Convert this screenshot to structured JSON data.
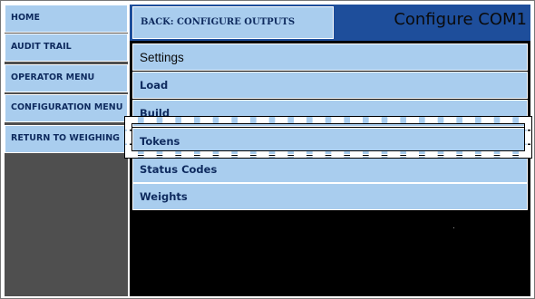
{
  "sidebar": {
    "items": [
      {
        "label": "HOME"
      },
      {
        "label": "AUDIT TRAIL"
      },
      {
        "label": "OPERATOR MENU"
      },
      {
        "label": "CONFIGURATION MENU"
      },
      {
        "label": "RETURN TO WEIGHING"
      }
    ]
  },
  "header": {
    "back_label": "BACK: CONFIGURE OUTPUTS",
    "title": "Configure COM1"
  },
  "menu": {
    "section_label": "Settings",
    "items": [
      {
        "label": "Load"
      },
      {
        "label": "Build"
      },
      {
        "label": "Tokens",
        "highlighted": true
      },
      {
        "label": "Status Codes"
      },
      {
        "label": "Weights"
      }
    ]
  },
  "colors": {
    "button_fill": "#a9cdee",
    "title_bar": "#1e4e9b",
    "sidebar_bg": "#4f4f4f",
    "main_bg": "#000000",
    "text": "#0e2a5e"
  }
}
